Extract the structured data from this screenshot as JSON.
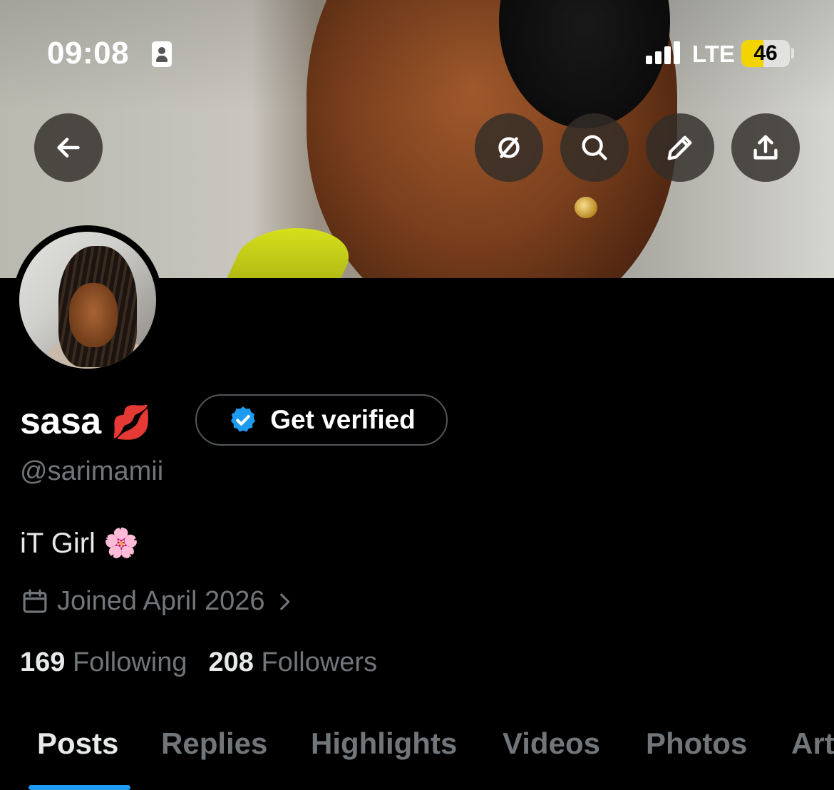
{
  "status_bar": {
    "time": "09:08",
    "network": "LTE",
    "battery_percent": 46,
    "battery_label": "46",
    "signal_bars": 4,
    "battery_color": "#f4d400"
  },
  "header": {
    "back_icon": "arrow-left-icon",
    "actions": [
      "no-grok-icon",
      "search-icon",
      "pencil-icon",
      "share-icon"
    ]
  },
  "profile": {
    "name": "sasa",
    "name_emoji": "💋",
    "verify_button_label": "Get verified",
    "handle": "@sarimamii",
    "bio": "iT Girl 🌸",
    "joined": "Joined April 2026",
    "following_count": "169",
    "following_label": "Following",
    "followers_count": "208",
    "followers_label": "Followers"
  },
  "tabs": [
    {
      "label": "Posts",
      "active": true
    },
    {
      "label": "Replies",
      "active": false
    },
    {
      "label": "Highlights",
      "active": false
    },
    {
      "label": "Videos",
      "active": false
    },
    {
      "label": "Photos",
      "active": false
    },
    {
      "label": "Art",
      "active": false
    }
  ],
  "colors": {
    "accent": "#1d9bf0",
    "muted_text": "#71767b",
    "background": "#000000"
  }
}
